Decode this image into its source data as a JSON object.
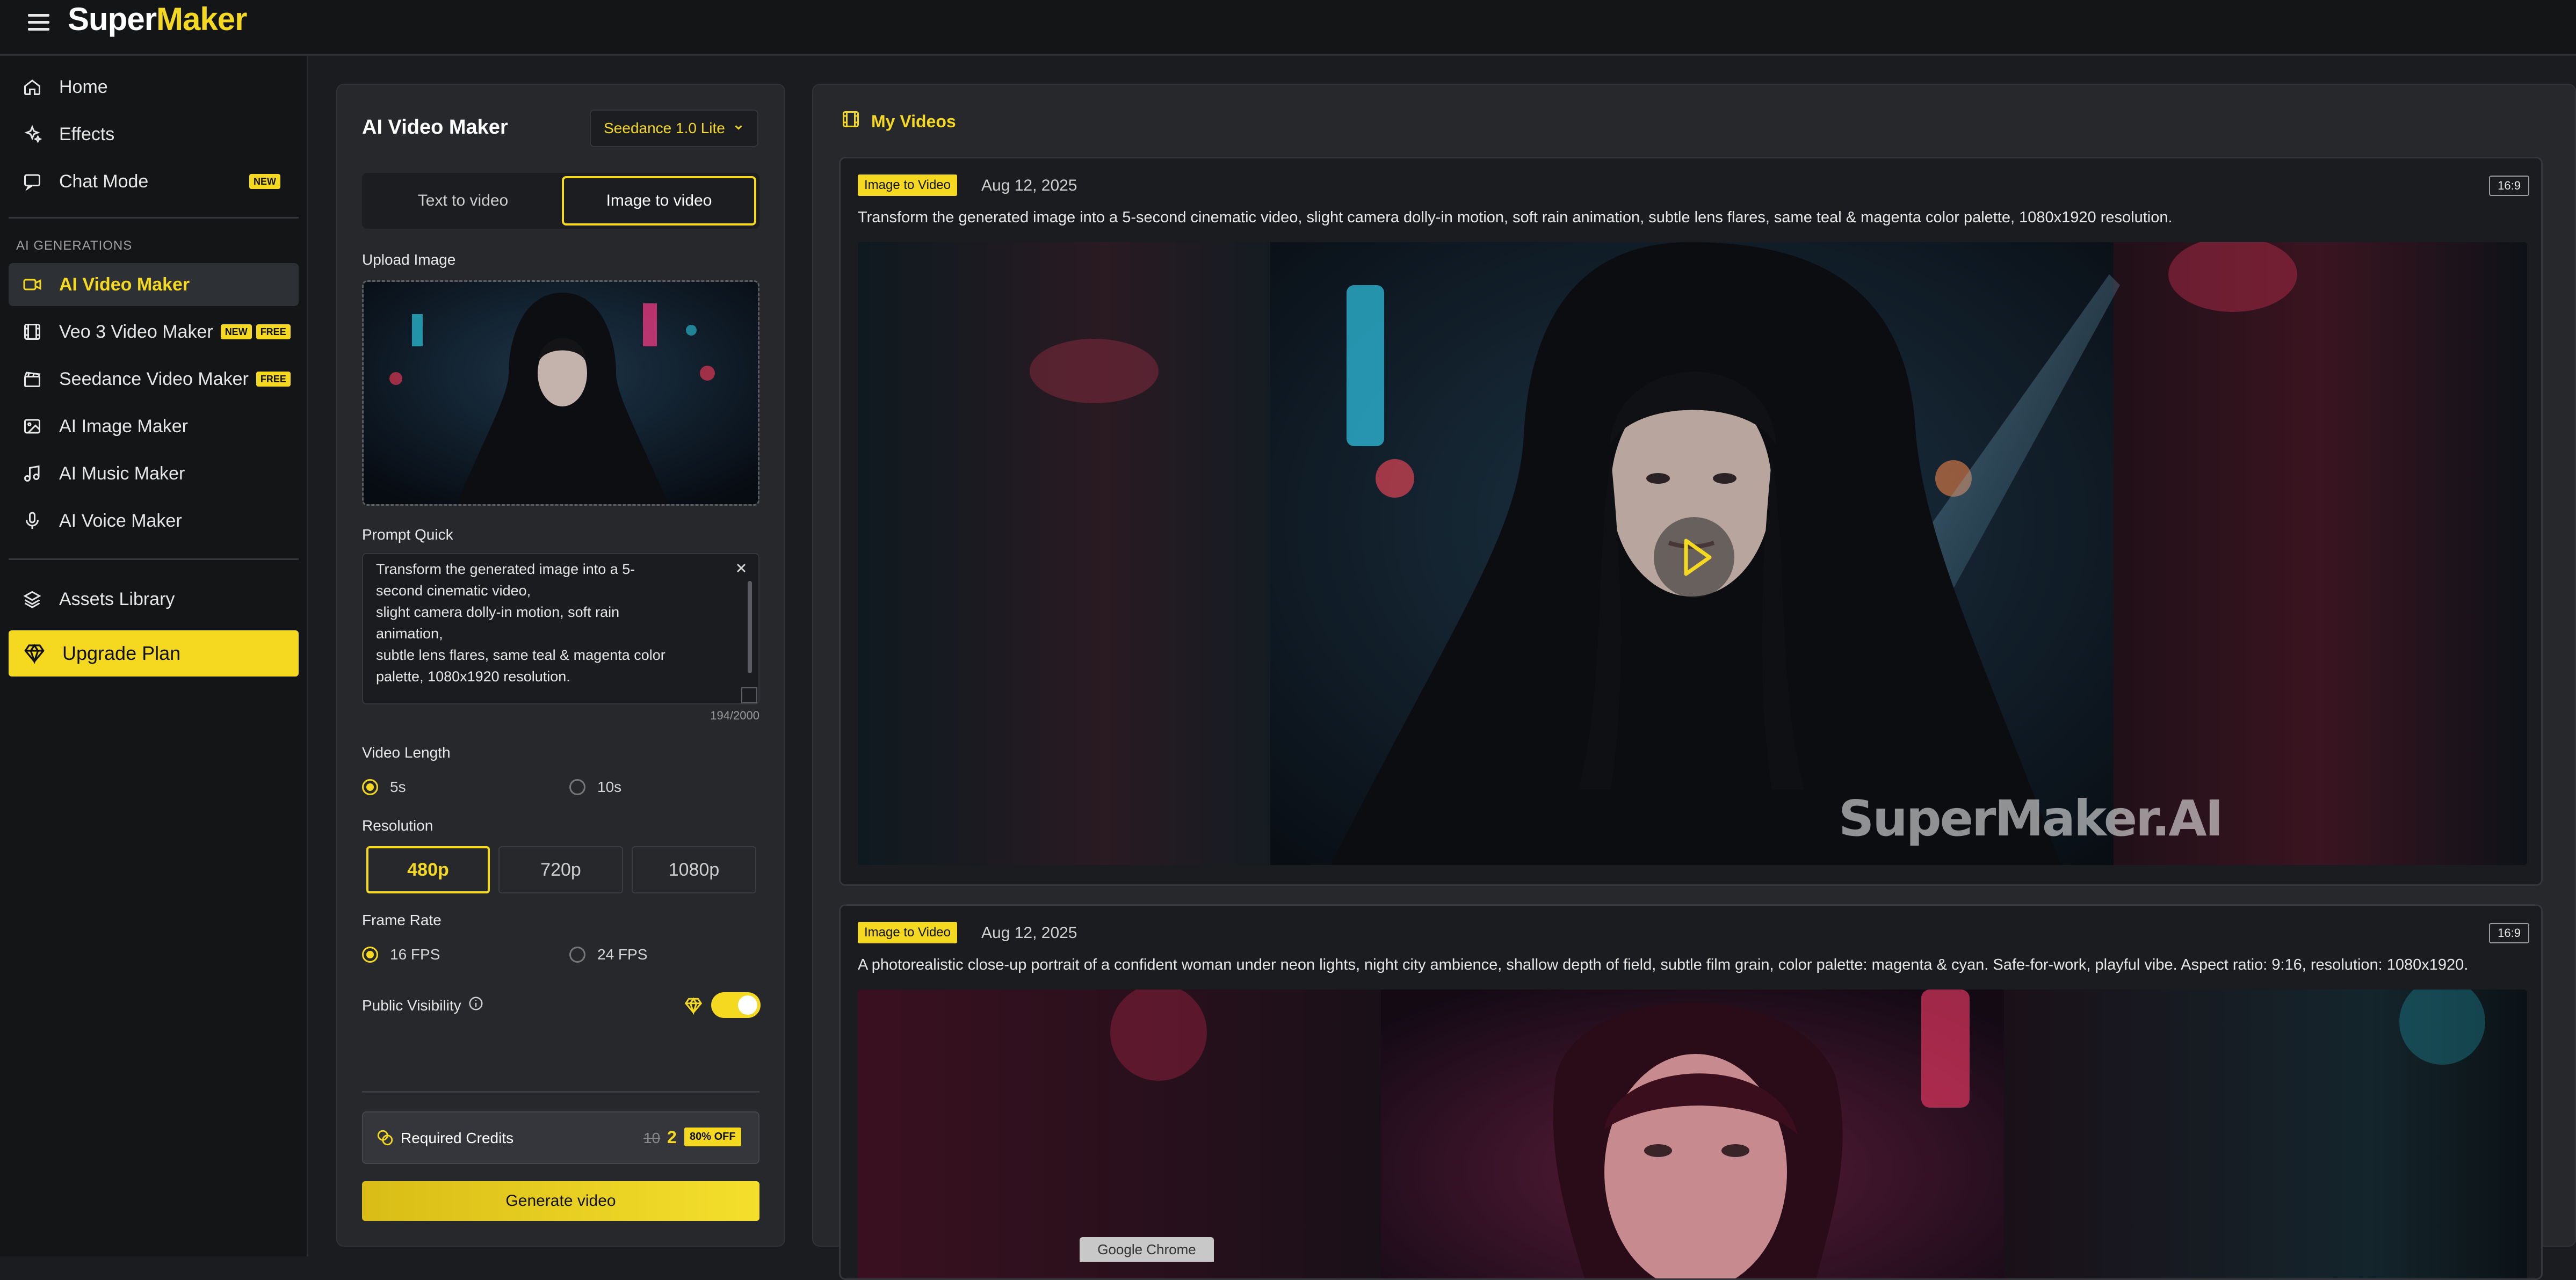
{
  "app": {
    "logo_part1": "Super",
    "logo_part2": "Maker"
  },
  "sidebar": {
    "items": [
      {
        "label": "Home",
        "icon": "home-icon"
      },
      {
        "label": "Effects",
        "icon": "sparkles-icon"
      },
      {
        "label": "Chat Mode",
        "icon": "chat-icon",
        "badge": "NEW"
      }
    ],
    "section_title": "AI GENERATIONS",
    "generations": [
      {
        "label": "AI Video Maker",
        "icon": "video-camera-icon",
        "active": true
      },
      {
        "label": "Veo 3 Video Maker",
        "icon": "film-icon",
        "badges": [
          "NEW",
          "FREE"
        ]
      },
      {
        "label": "Seedance Video Maker",
        "icon": "clapperboard-icon",
        "badges": [
          "FREE"
        ]
      },
      {
        "label": "AI Image Maker",
        "icon": "image-icon"
      },
      {
        "label": "AI Music Maker",
        "icon": "music-note-icon"
      },
      {
        "label": "AI Voice Maker",
        "icon": "microphone-icon"
      }
    ],
    "assets_label": "Assets Library",
    "upgrade_label": "Upgrade Plan"
  },
  "panel": {
    "title": "AI Video Maker",
    "model": "Seedance 1.0 Lite",
    "tabs": [
      "Text to video",
      "Image to video"
    ],
    "selected_tab": "Image to video",
    "upload_label": "Upload Image",
    "prompt_label": "Prompt  Quick",
    "prompt_value": "Transform the generated image into a 5-\nsecond cinematic video,\nslight camera dolly-in motion, soft rain\nanimation,\nsubtle lens flares, same teal & magenta color\npalette, 1080x1920 resolution.",
    "char_count": "194/2000",
    "video_length_label": "Video Length",
    "video_length_options": [
      "5s",
      "10s"
    ],
    "video_length_selected": "5s",
    "resolution_label": "Resolution",
    "resolution_options": [
      "480p",
      "720p",
      "1080p"
    ],
    "resolution_selected": "480p",
    "frame_rate_label": "Frame Rate",
    "frame_rate_options": [
      "16 FPS",
      "24 FPS"
    ],
    "frame_rate_selected": "16 FPS",
    "visibility_label": "Public Visibility",
    "visibility_on": true,
    "credits_label": "Required Credits",
    "credits_old": "10",
    "credits_new": "2",
    "credits_discount": "80% OFF",
    "generate_label": "Generate video"
  },
  "videos": {
    "title": "My Videos",
    "items": [
      {
        "tag": "Image to Video",
        "date": "Aug 12, 2025",
        "ratio": "16:9",
        "prompt": "Transform the generated image into a 5-second cinematic video, slight camera dolly-in motion, soft rain animation, subtle lens flares, same teal & magenta color palette, 1080x1920 resolution.",
        "watermark": "SuperMaker.AI"
      },
      {
        "tag": "Image to Video",
        "date": "Aug 12, 2025",
        "ratio": "16:9",
        "prompt": "A photorealistic close-up portrait of a confident woman under neon lights, night city ambience, shallow depth of field, subtle film grain, color palette: magenta & cyan. Safe-for-work, playful vibe. Aspect ratio: 9:16, resolution: 1080x1920."
      }
    ]
  },
  "tooltip": "Google Chrome",
  "colors": {
    "accent": "#f5d820",
    "background": "#1b1c1f",
    "panel": "#26282c"
  }
}
